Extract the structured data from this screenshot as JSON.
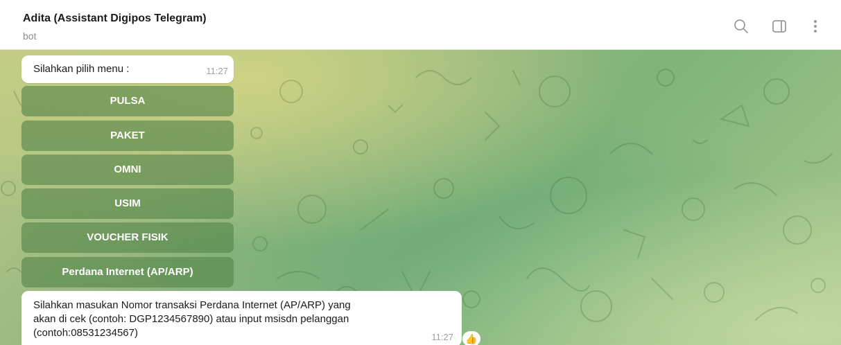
{
  "header": {
    "title": "Adita (Assistant Digipos Telegram)",
    "subtitle": "bot",
    "icons": [
      "search-icon",
      "sidebar-toggle-icon",
      "more-vertical-icon"
    ]
  },
  "messages": {
    "menu_prompt": {
      "text": "Silahkan pilih menu :",
      "time": "11:27"
    },
    "keyboard": [
      {
        "label": "PULSA"
      },
      {
        "label": "PAKET"
      },
      {
        "label": "OMNI"
      },
      {
        "label": "USIM"
      },
      {
        "label": "VOUCHER FISIK"
      },
      {
        "label": "Perdana Internet (AP/ARP)"
      }
    ],
    "input_prompt": {
      "text": "Silahkan masukan Nomor transaksi Perdana Internet (AP/ARP) yang\nakan di cek (contoh: DGP1234567890) atau input msisdn pelanggan\n(contoh:08531234567)",
      "time": "11:27",
      "reaction": "👍"
    }
  },
  "colors": {
    "button_bg": "#548448",
    "bubble_bg": "#ffffff",
    "time_text": "#9aa39a",
    "header_title": "#1b1b1b",
    "header_subtitle": "#8d8d8d"
  }
}
